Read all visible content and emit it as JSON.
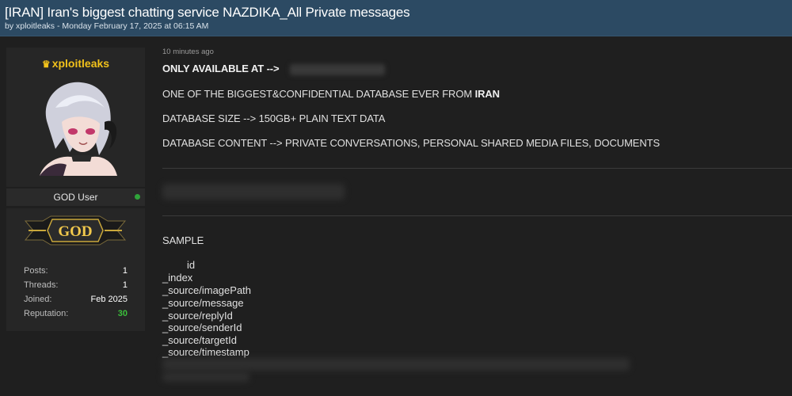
{
  "thread": {
    "title": "[IRAN] Iran's biggest chatting service NAZDIKA_All Private messages",
    "meta": "by xploitleaks - Monday February 17, 2025 at 06:15 AM"
  },
  "user": {
    "crown_icon": "crown-icon",
    "name": "xploitleaks",
    "rank": "GOD User",
    "badge_text": "GOD",
    "stats": [
      {
        "label": "Posts:",
        "value": "1"
      },
      {
        "label": "Threads:",
        "value": "1"
      },
      {
        "label": "Joined:",
        "value": "Feb 2025"
      },
      {
        "label": "Reputation:",
        "value": "30"
      }
    ],
    "colors": {
      "username": "#f2c21b",
      "online": "#2fa33a",
      "reputation": "#3bbf3b"
    }
  },
  "post": {
    "time": "10 minutes ago",
    "available_label": "ONLY AVAILABLE AT -->",
    "line1_prefix": "ONE OF THE BIGGEST&CONFIDENTIAL DATABASE EVER FROM ",
    "line1_bold": "IRAN",
    "line2": "DATABASE SIZE --> 150GB+ PLAIN TEXT DATA",
    "line3": "DATABASE CONTENT --> PRIVATE CONVERSATIONS, PERSONAL SHARED MEDIA FILES, DOCUMENTS",
    "sample_label": "SAMPLE",
    "fields": [
      "id",
      "_index",
      "_source/imagePath",
      "_source/message",
      "_source/replyId",
      "_source/senderId",
      "_source/targetId",
      "_source/timestamp"
    ]
  }
}
